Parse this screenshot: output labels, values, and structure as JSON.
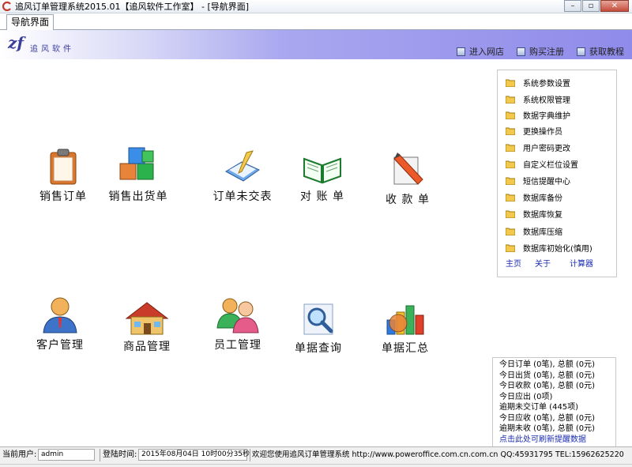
{
  "window": {
    "title": "追风订单管理系统2015.01【追风软件工作室】 - [导航界面]",
    "buttons": {
      "minimize": "–",
      "restore": "▫",
      "close": "✕"
    }
  },
  "tab": {
    "label": "导航界面"
  },
  "banner": {
    "logo_mark": "zf",
    "logo_text": "追风软件",
    "links": [
      "进入网店",
      "购买注册",
      "获取教程"
    ]
  },
  "nav": {
    "sales_order": "销售订单",
    "sales_shipment": "销售出货单",
    "order_unshipped": "订单未交表",
    "statement": "对 账 单",
    "receipt": "收 款 单",
    "customer_mgmt": "客户管理",
    "product_mgmt": "商品管理",
    "employee_mgmt": "员工管理",
    "doc_query": "单据查询",
    "doc_summary": "单据汇总"
  },
  "settings": {
    "items": [
      "系统参数设置",
      "系统权限管理",
      "数据字典维护",
      "更换操作员",
      "用户密码更改",
      "自定义栏位设置",
      "短信提醒中心",
      "数据库备份",
      "数据库恢复",
      "数据库压缩",
      "数据库初始化(慎用)"
    ],
    "footer": {
      "home": "主页",
      "about": "关于",
      "calculator": "计算器"
    }
  },
  "stats": {
    "lines": [
      "今日订单 (0笔), 总额 (0元)",
      "今日出货 (0笔), 总额 (0元)",
      "今日收款 (0笔), 总额 (0元)",
      "今日应出 (0项)",
      "逾期未交订单 (445项)",
      "今日应收 (0笔), 总额 (0元)",
      "逾期未收 (0笔), 总额 (0元)"
    ],
    "refresh_link": "点击此处可刷新提醒数据"
  },
  "statusbar": {
    "user_label": "当前用户:",
    "user_value": "admin",
    "login_label": "登陆时间:",
    "login_value": "2015年08月04日 10时00分35秒",
    "welcome": "欢迎您使用追风订单管理系统  http://www.poweroffice.com.cn.com.cn  QQ:45931795  TEL:15962625220"
  }
}
